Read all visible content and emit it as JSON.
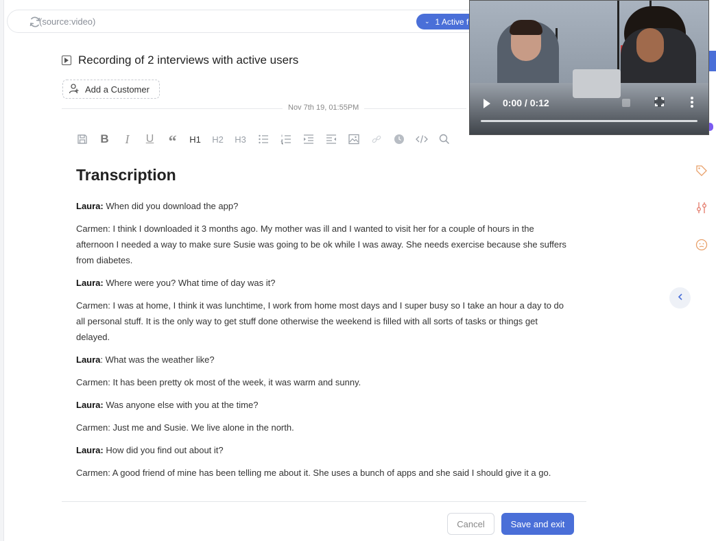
{
  "search": {
    "query": "(source:video)",
    "active_filter": "1 Active f"
  },
  "record": {
    "title": "Recording of 2 interviews with active users",
    "add_customer_label": "Add a Customer",
    "date": "Nov 7th 19, 01:55PM"
  },
  "toolbar": {
    "h1": "H1",
    "h2": "H2",
    "h3": "H3"
  },
  "document": {
    "heading": "Transcription",
    "paragraphs": [
      {
        "speaker": "Laura:",
        "text": " When did you download the app?"
      },
      {
        "speaker": "",
        "text": "Carmen: I think I downloaded it 3 months ago. My mother was ill and I wanted to visit her for a couple of hours in the afternoon I needed a way to make sure Susie was going to be ok while I was away. She needs exercise because she suffers from diabetes."
      },
      {
        "speaker": "Laura:",
        "text": " Where were you? What time of day was it?"
      },
      {
        "speaker": "",
        "text": "Carmen: I was at home, I think it was lunchtime, I work from home most days and I super busy so I take an hour a day to do all personal stuff. It is the only way to get stuff done otherwise the weekend is filled with all sorts of tasks or things get delayed."
      },
      {
        "speaker": "Laura",
        "text": ": What was the weather like?"
      },
      {
        "speaker": "",
        "text": "Carmen: It has been pretty ok most of the week, it was warm and sunny."
      },
      {
        "speaker": "Laura:",
        "text": " Was anyone else with you at the time?"
      },
      {
        "speaker": "",
        "text": "Carmen: Just me and Susie. We live alone in the north."
      },
      {
        "speaker": "Laura:",
        "text": " How did you find out about it?"
      },
      {
        "speaker": "",
        "text": "Carmen: A good friend of mine has been telling me about it. She uses a bunch of apps and she said I should give it a go."
      }
    ]
  },
  "actions": {
    "cancel": "Cancel",
    "save": "Save and exit"
  },
  "video": {
    "time": "0:00 / 0:12",
    "progress": 0
  },
  "colors": {
    "accent": "#4a6fd8",
    "tag_icon": "#e8a06a",
    "purple_dot": "#7b5cf0"
  }
}
